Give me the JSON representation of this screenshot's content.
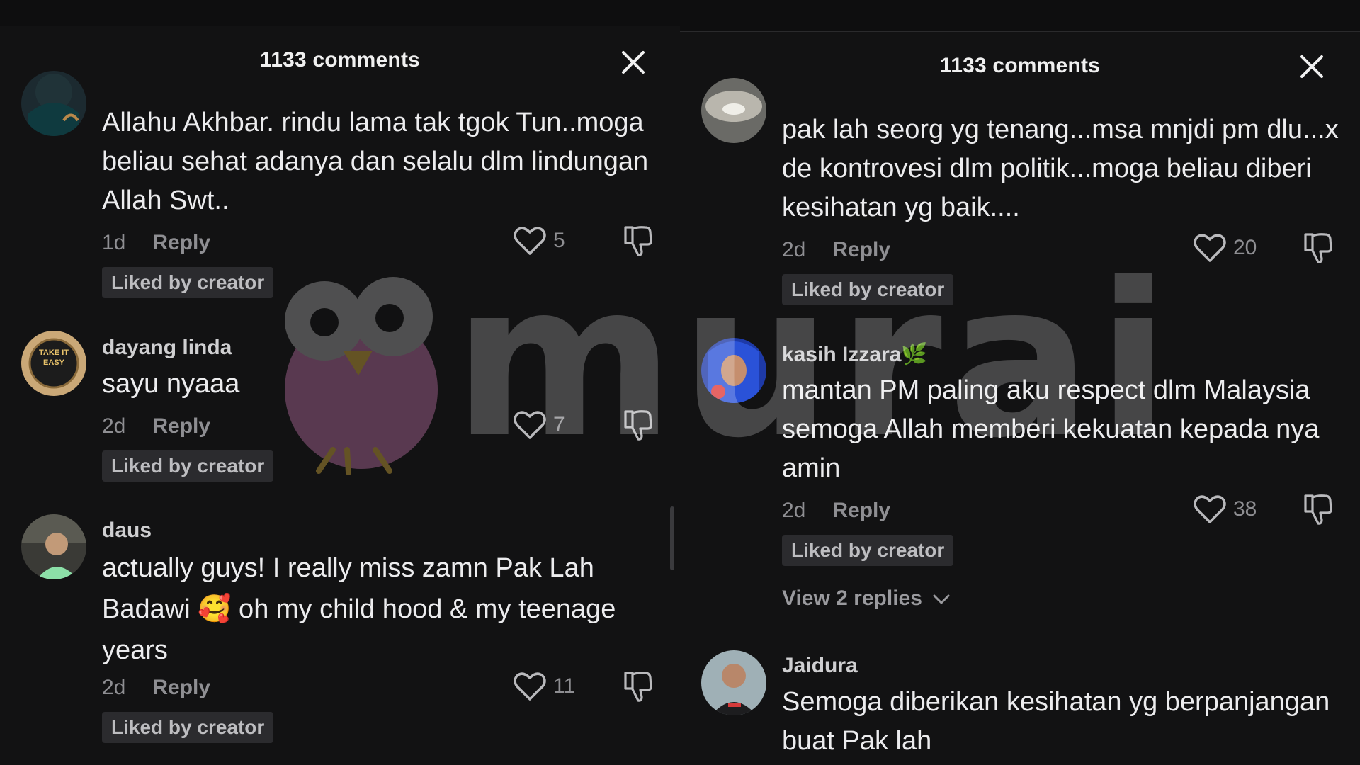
{
  "left_panel": {
    "header": {
      "title": "1133 comments"
    },
    "comments": [
      {
        "username": "",
        "text": "Allahu Akhbar. rindu lama tak tgok Tun..moga beliau sehat adanya dan selalu dlm lindungan Allah Swt..",
        "time": "1d",
        "reply_label": "Reply",
        "likes": "5",
        "badge": "Liked by creator"
      },
      {
        "username": "dayang linda",
        "text": "sayu nyaaa",
        "time": "2d",
        "reply_label": "Reply",
        "likes": "7",
        "badge": "Liked by creator",
        "avatar_text": "TAKE IT EASY"
      },
      {
        "username": "daus",
        "text": "actually guys! I really miss zamn Pak Lah Badawi 🥰 oh my child hood & my teenage years",
        "time": "2d",
        "reply_label": "Reply",
        "likes": "11",
        "badge": "Liked by creator"
      }
    ]
  },
  "right_panel": {
    "header": {
      "title": "1133 comments"
    },
    "comments": [
      {
        "username": "",
        "text": "pak lah seorg yg tenang...msa mnjdi pm dlu...x de kontrovesi dlm politik...moga beliau diberi kesihatan yg baik....",
        "time": "2d",
        "reply_label": "Reply",
        "likes": "20",
        "badge": "Liked by creator"
      },
      {
        "username": "kasih Izzara🌿",
        "text": "mantan PM paling aku respect dlm Malaysia semoga Allah memberi kekuatan kepada nya amin",
        "time": "2d",
        "reply_label": "Reply",
        "likes": "38",
        "badge": "Liked by creator",
        "view_replies": "View 2 replies"
      },
      {
        "username": "Jaidura",
        "text": "Semoga diberikan kesihatan yg berpanjangan buat Pak lah"
      }
    ]
  },
  "watermark": {
    "text": "murai"
  },
  "icons": {
    "close": "close-icon",
    "like": "heart-outline-icon",
    "dislike": "thumbs-down-icon",
    "chevron": "chevron-down-icon",
    "mascot": "owl-mascot-icon"
  },
  "colors": {
    "background": "#121213",
    "text": "#ececee",
    "muted": "#8e8e92",
    "badge_bg": "#2b2b2e",
    "watermark": "#b06a9a"
  }
}
